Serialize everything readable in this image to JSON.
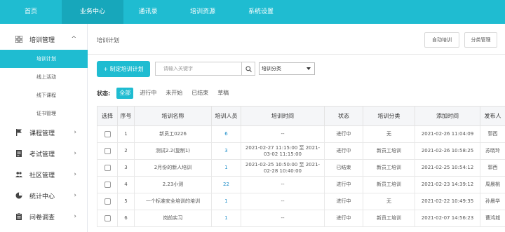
{
  "topnav": [
    "首页",
    "业务中心",
    "通讯录",
    "培训资源",
    "系统设置"
  ],
  "sidebar": {
    "training_group": "培训管理",
    "training_sub": [
      "培训计划",
      "线上活动",
      "线下课程",
      "证书管理"
    ],
    "others": [
      "课程管理",
      "考试管理",
      "社区管理",
      "统计中心",
      "问卷调查"
    ]
  },
  "breadcrumb": "培训计划",
  "toolbar": {
    "auto_label": "自动培训",
    "category_label": "分类管理"
  },
  "add_button": "+ 制定培训计划",
  "search": {
    "placeholder": "请输入关键字"
  },
  "select": {
    "value": "培训分类"
  },
  "status": {
    "label": "状态:",
    "filters": [
      "全部",
      "进行中",
      "未开始",
      "已结束",
      "草稿"
    ]
  },
  "table": {
    "headers": [
      "选择",
      "序号",
      "培训名称",
      "培训人员",
      "培训时间",
      "状态",
      "培训分类",
      "添加时间",
      "发布人"
    ],
    "rows": [
      {
        "no": "1",
        "name": "新员工0226",
        "staff": "6",
        "time": "--",
        "status": "进行中",
        "category": "无",
        "added": "2021-02-26 11:04:09",
        "publisher": "郭西"
      },
      {
        "no": "2",
        "name": "测试2.2(复制1)",
        "staff": "3",
        "time": "2021-02-27 11:15:00 至 2021-03-02 11:15:00",
        "status": "进行中",
        "category": "新员工培训",
        "added": "2021-02-26 10:58:25",
        "publisher": "苏晓玲"
      },
      {
        "no": "3",
        "name": "2月份的新人培训",
        "staff": "1",
        "time": "2021-02-25 10:50:00 至 2021-02-28 10:40:00",
        "status": "已结束",
        "category": "新员工培训",
        "added": "2021-02-25 10:54:12",
        "publisher": "郭西"
      },
      {
        "no": "4",
        "name": "2.23小测",
        "staff": "22",
        "time": "--",
        "status": "进行中",
        "category": "新员工培训",
        "added": "2021-02-23 14:39:12",
        "publisher": "周晨桃"
      },
      {
        "no": "5",
        "name": "一个标准安全培训的培训",
        "staff": "1",
        "time": "--",
        "status": "进行中",
        "category": "无",
        "added": "2021-02-22 10:49:35",
        "publisher": "孙晨华"
      },
      {
        "no": "6",
        "name": "岗前实习",
        "staff": "1",
        "time": "--",
        "status": "进行中",
        "category": "新员工培训",
        "added": "2021-02-07 14:56:23",
        "publisher": "曹鸿城"
      }
    ]
  },
  "colors": {
    "accent": "#1fbcd1",
    "accent_dark": "#17a7bb",
    "link": "#1f8fc9"
  }
}
